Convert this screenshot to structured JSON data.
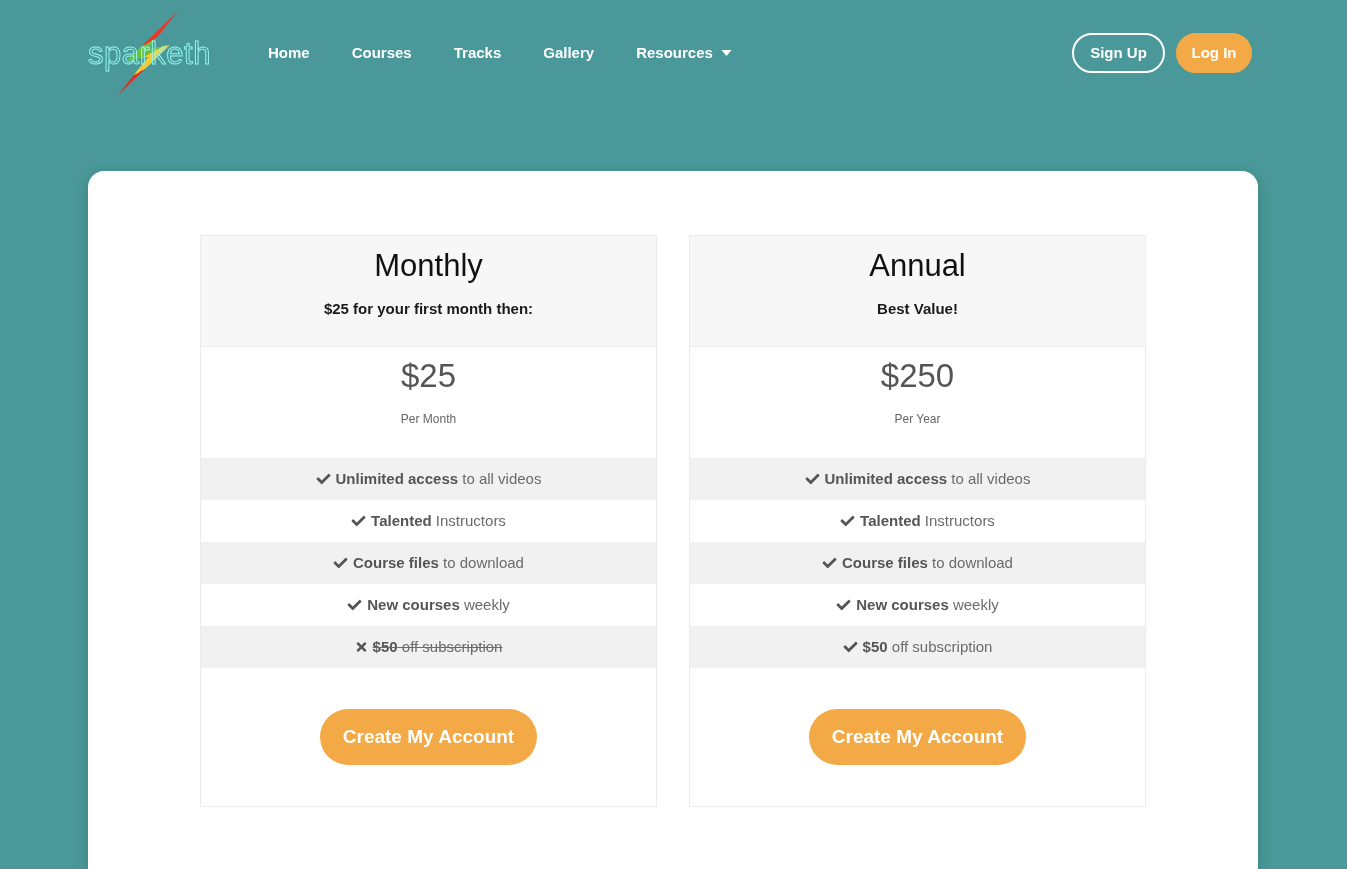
{
  "header": {
    "logo": "sparketh",
    "nav": [
      {
        "label": "Home",
        "has_menu": false
      },
      {
        "label": "Courses",
        "has_menu": false
      },
      {
        "label": "Tracks",
        "has_menu": false
      },
      {
        "label": "Gallery",
        "has_menu": false
      },
      {
        "label": "Resources",
        "has_menu": true
      }
    ],
    "buttons": [
      {
        "label": "Sign Up",
        "kind": "outline"
      },
      {
        "label": "Log In",
        "kind": "filled"
      }
    ]
  },
  "plans": [
    {
      "name": "Monthly",
      "note": "$25 for your first month then:",
      "price": "$25",
      "period": "Per Month",
      "features": [
        {
          "text": "**Unlimited access** to all videos",
          "included": true
        },
        {
          "text": "**Talented** Instructors",
          "included": true
        },
        {
          "text": "**Course files** to download",
          "included": true
        },
        {
          "text": "**New courses** weekly",
          "included": true
        },
        {
          "text": "**$50** off subscription",
          "included": false
        }
      ],
      "button": "Create My Account"
    },
    {
      "name": "Annual",
      "note": "Best Value!",
      "price": "$250",
      "period": "Per Year",
      "features": [
        {
          "text": "**Unlimited access** to all videos",
          "included": true
        },
        {
          "text": "**Talented** Instructors",
          "included": true
        },
        {
          "text": "**Course files** to download",
          "included": true
        },
        {
          "text": "**New courses** weekly",
          "included": true
        },
        {
          "text": "**$50** off subscription",
          "included": true
        }
      ],
      "button": "Create My Account"
    }
  ]
}
